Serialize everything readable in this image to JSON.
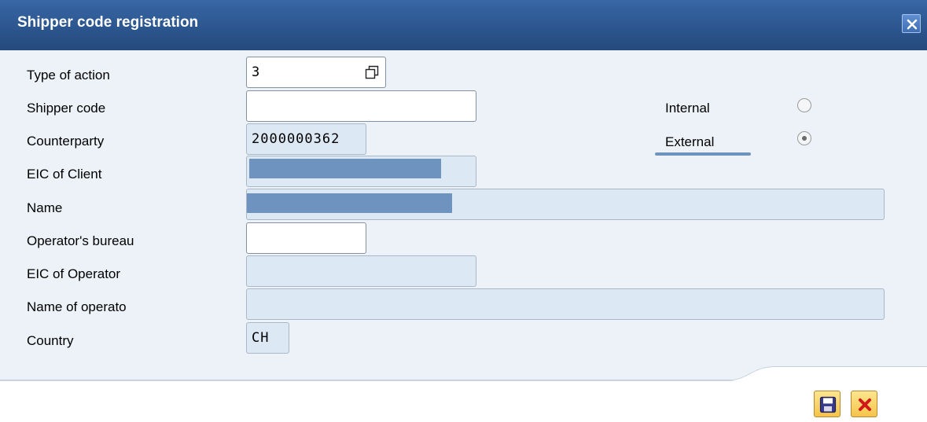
{
  "window": {
    "title": "Shipper code registration",
    "close_icon": "close-icon"
  },
  "form": {
    "type_of_action": {
      "label": "Type of action",
      "value": "3"
    },
    "shipper_code": {
      "label": "Shipper code",
      "value": ""
    },
    "counterparty": {
      "label": "Counterparty",
      "value": "2000000362"
    },
    "eic_of_client": {
      "label": "EIC of Client",
      "value": ""
    },
    "name": {
      "label": "Name",
      "value": ""
    },
    "operators_bureau": {
      "label": "Operator's bureau",
      "value": ""
    },
    "eic_of_operator": {
      "label": "EIC of Operator",
      "value": ""
    },
    "name_of_operator": {
      "label": "Name of operato",
      "value": ""
    },
    "country": {
      "label": "Country",
      "value": "CH"
    }
  },
  "shipper_type": {
    "options": [
      {
        "label": "Internal",
        "selected": false
      },
      {
        "label": "External",
        "selected": true
      }
    ]
  },
  "toolbar": {
    "save_icon": "save-icon",
    "cancel_icon": "cancel-icon"
  },
  "colors": {
    "title_bar": "#2c568f",
    "body_background": "#ecf2f8",
    "readonly_field": "#dce8f3",
    "redaction": "#6f93bf",
    "button_face": "#f4c44a",
    "cancel_cross": "#d01818"
  }
}
